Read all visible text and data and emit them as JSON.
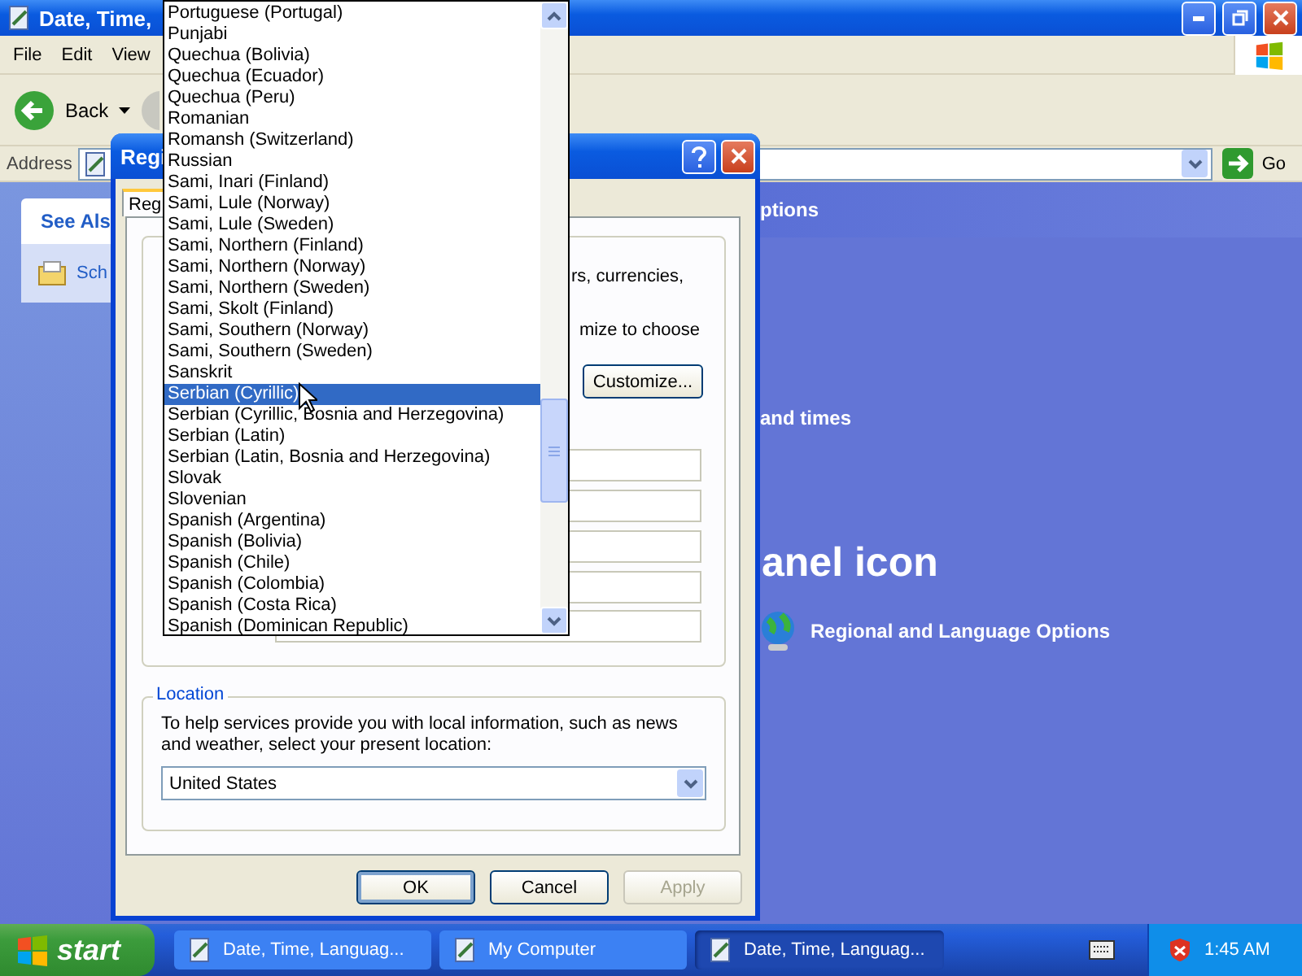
{
  "explorer": {
    "title": "Date, Time,",
    "menu": [
      "File",
      "Edit",
      "View"
    ],
    "back": "Back",
    "address_label": "Address",
    "go": "Go",
    "task_pane": {
      "heading": "See Als",
      "item": "Sch"
    },
    "content": {
      "header": "ptions",
      "section": "and times",
      "heading": "anel icon",
      "link": "Regional and Language Options"
    }
  },
  "dialog": {
    "title": "Regi",
    "tab": "Reg",
    "fragments": [
      "rs, currencies,",
      "mize to choose"
    ],
    "customize": "Customize...",
    "location": {
      "label": "Location",
      "text": "To help services provide you with local information, such as news and weather, select your present location:",
      "value": "United States"
    },
    "buttons": [
      {
        "label": "OK",
        "default": true,
        "disabled": false
      },
      {
        "label": "Cancel",
        "default": false,
        "disabled": false
      },
      {
        "label": "Apply",
        "default": false,
        "disabled": true
      }
    ]
  },
  "dropdown": {
    "items": [
      {
        "label": "Portuguese (Portugal)",
        "selected": false
      },
      {
        "label": "Punjabi",
        "selected": false
      },
      {
        "label": "Quechua (Bolivia)",
        "selected": false
      },
      {
        "label": "Quechua (Ecuador)",
        "selected": false
      },
      {
        "label": "Quechua (Peru)",
        "selected": false
      },
      {
        "label": "Romanian",
        "selected": false
      },
      {
        "label": "Romansh (Switzerland)",
        "selected": false
      },
      {
        "label": "Russian",
        "selected": false
      },
      {
        "label": "Sami, Inari (Finland)",
        "selected": false
      },
      {
        "label": "Sami, Lule (Norway)",
        "selected": false
      },
      {
        "label": "Sami, Lule (Sweden)",
        "selected": false
      },
      {
        "label": "Sami, Northern (Finland)",
        "selected": false
      },
      {
        "label": "Sami, Northern (Norway)",
        "selected": false
      },
      {
        "label": "Sami, Northern (Sweden)",
        "selected": false
      },
      {
        "label": "Sami, Skolt (Finland)",
        "selected": false
      },
      {
        "label": "Sami, Southern (Norway)",
        "selected": false
      },
      {
        "label": "Sami, Southern (Sweden)",
        "selected": false
      },
      {
        "label": "Sanskrit",
        "selected": false
      },
      {
        "label": "Serbian (Cyrillic)",
        "selected": true
      },
      {
        "label": "Serbian (Cyrillic, Bosnia and Herzegovina)",
        "selected": false
      },
      {
        "label": "Serbian (Latin)",
        "selected": false
      },
      {
        "label": "Serbian (Latin, Bosnia and Herzegovina)",
        "selected": false
      },
      {
        "label": "Slovak",
        "selected": false
      },
      {
        "label": "Slovenian",
        "selected": false
      },
      {
        "label": "Spanish (Argentina)",
        "selected": false
      },
      {
        "label": "Spanish (Bolivia)",
        "selected": false
      },
      {
        "label": "Spanish (Chile)",
        "selected": false
      },
      {
        "label": "Spanish (Colombia)",
        "selected": false
      },
      {
        "label": "Spanish (Costa Rica)",
        "selected": false
      },
      {
        "label": "Spanish (Dominican Republic)",
        "selected": false
      }
    ]
  },
  "taskbar": {
    "start": "start",
    "tasks": [
      {
        "label": "Date, Time, Languag...",
        "selected": false
      },
      {
        "label": "My Computer",
        "selected": false
      },
      {
        "label": "Date, Time, Languag...",
        "selected": true
      }
    ],
    "clock": "1:45 AM"
  }
}
